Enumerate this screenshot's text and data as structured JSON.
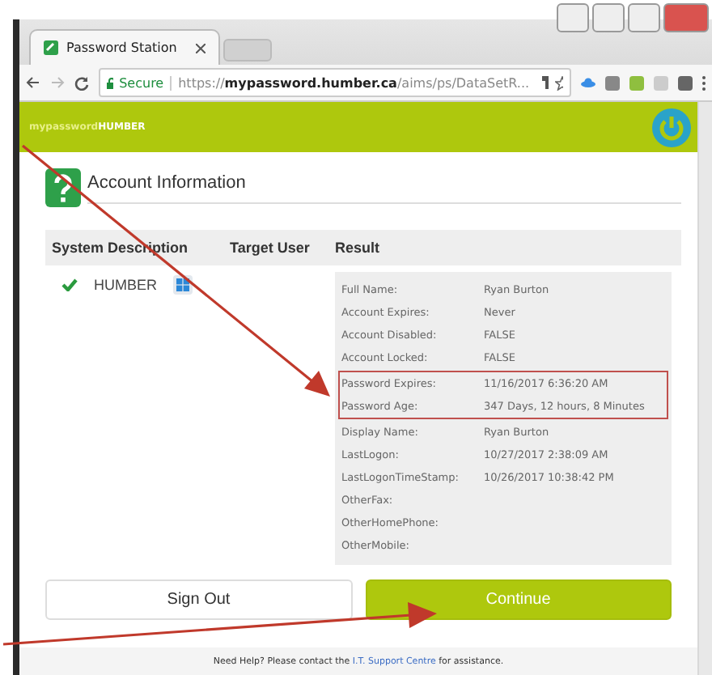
{
  "browser": {
    "tab_title": "Password Station",
    "url": "https://**mypassword.humber.ca**/aims/ps/DataSetR...",
    "secure_label": "Secure"
  },
  "header": {
    "brand_prefix": "mypassword",
    "brand_suffix": "HUMBER"
  },
  "section_title": "Account Information",
  "table": {
    "columns": [
      "System Description",
      "Target User",
      "Result"
    ],
    "system": "HUMBER",
    "status_ok": true
  },
  "results": [
    {
      "label": "Full Name:",
      "value": "Ryan Burton",
      "highlighted": false
    },
    {
      "label": "Account Expires:",
      "value": "Never",
      "highlighted": false
    },
    {
      "label": "Account Disabled:",
      "value": "FALSE",
      "highlighted": false
    },
    {
      "label": "Account Locked:",
      "value": "FALSE",
      "highlighted": false
    },
    {
      "label": "Password Expires:",
      "value": "11/16/2017 6:36:20 AM",
      "highlighted": true
    },
    {
      "label": "Password Age:",
      "value": "347 Days, 12 hours, 8 Minutes",
      "highlighted": true
    },
    {
      "label": "Display Name:",
      "value": "Ryan Burton",
      "highlighted": false
    },
    {
      "label": "LastLogon:",
      "value": "10/27/2017 2:38:09 AM",
      "highlighted": false
    },
    {
      "label": "LastLogonTimeStamp:",
      "value": "10/26/2017 10:38:42 PM",
      "highlighted": false
    },
    {
      "label": "OtherFax:",
      "highlighted": false
    },
    {
      "label": "OtherHomePhone:",
      "highlighted": false
    },
    {
      "label": "OtherMobile:",
      "highlighted": false
    }
  ],
  "buttons": [
    {
      "label": "Sign Out",
      "kind": "secondary"
    },
    {
      "label": "Continue",
      "kind": "primary"
    }
  ],
  "footer": {
    "before": "Need Help? Please contact the",
    "link": "I.T. Support Centre",
    "after": "for assistance."
  }
}
